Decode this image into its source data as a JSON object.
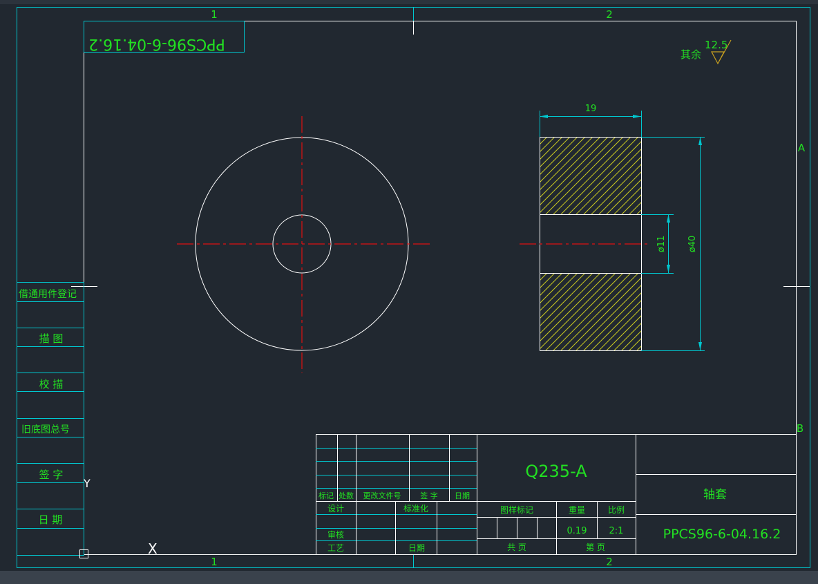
{
  "zones": {
    "top_1": "1",
    "top_2": "2",
    "bottom_1": "1",
    "bottom_2": "2",
    "right_a": "A",
    "right_b": "B"
  },
  "drawing_number_mirrored": "PPCS96-6-04.16.2",
  "roughness": {
    "label": "其余",
    "value": "12.5"
  },
  "dimensions": {
    "width": "19",
    "bore": "ø11",
    "outer": "ø40"
  },
  "left_panel": [
    "借通用件登记",
    "描 图",
    "校 描",
    "旧底图总号",
    "签 字",
    "日 期"
  ],
  "title_block": {
    "rev_headers": [
      "标记",
      "处数",
      "更改文件号",
      "签 字",
      "日期"
    ],
    "design": "设计",
    "standardization": "标准化",
    "review": "审核",
    "process": "工艺",
    "date": "日期",
    "material": "Q235-A",
    "figure_mark": "图样标记",
    "weight_label": "重量",
    "scale_label": "比例",
    "weight_value": "0.19",
    "scale_value": "2:1",
    "total_sheets": "共   页",
    "sheet_no": "第   页",
    "part_name": "轴套",
    "drawing_number": "PPCS96-6-04.16.2"
  },
  "ucs": {
    "y": "Y",
    "x": "X"
  }
}
